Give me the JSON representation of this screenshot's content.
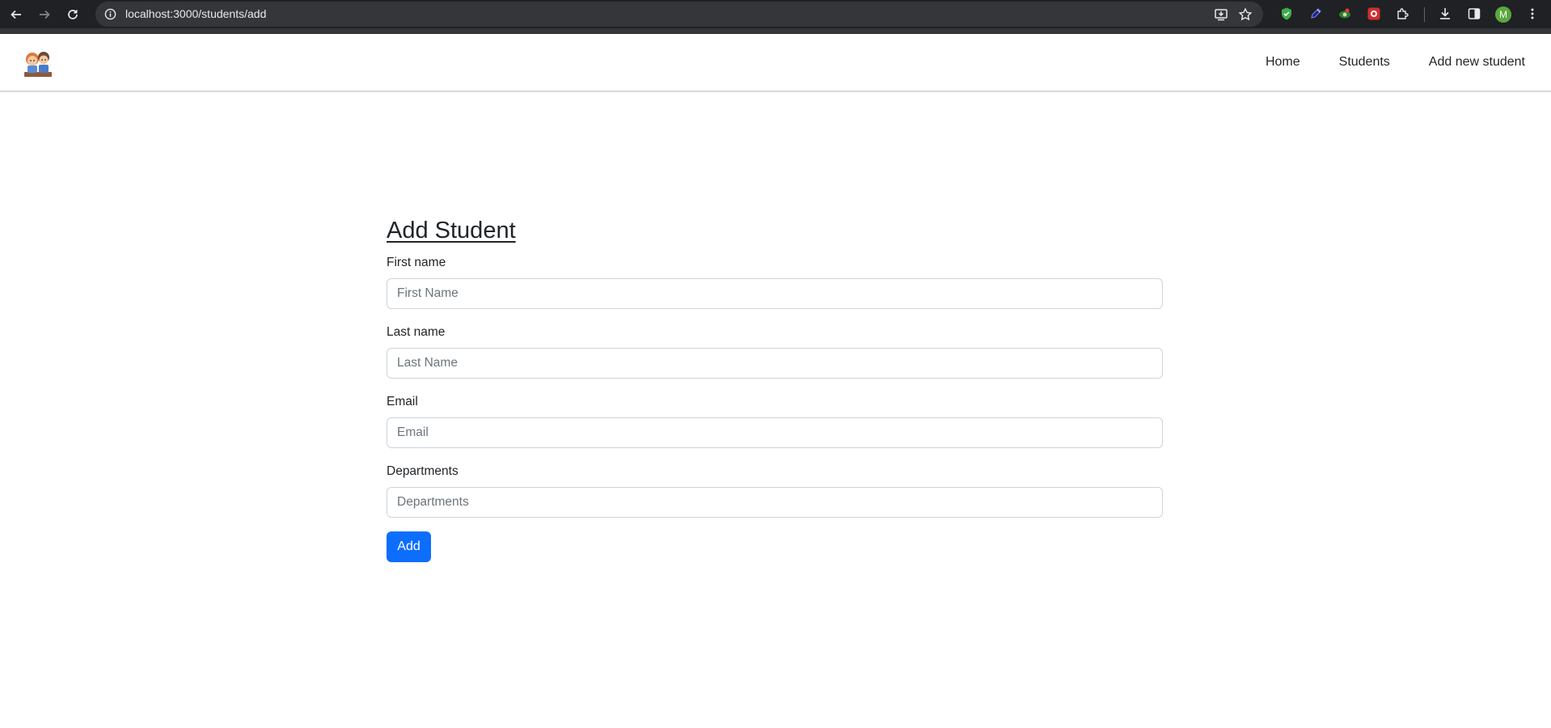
{
  "browser": {
    "url": "localhost:3000/students/add",
    "profile_initial": "M",
    "icons": [
      "back-icon",
      "forward-icon",
      "reload-icon",
      "site-info-icon",
      "install-app-icon",
      "bookmark-star-icon",
      "shield-extension-icon",
      "pen-extension-icon",
      "eye-extension-icon",
      "red-extension-icon",
      "extensions-puzzle-icon",
      "download-icon",
      "side-panel-icon",
      "menu-dots-icon"
    ]
  },
  "navbar": {
    "links": [
      "Home",
      "Students",
      "Add new student"
    ]
  },
  "form": {
    "title": "Add Student",
    "fields": [
      {
        "label": "First name",
        "placeholder": "First Name",
        "value": ""
      },
      {
        "label": "Last name",
        "placeholder": "Last Name",
        "value": ""
      },
      {
        "label": "Email",
        "placeholder": "Email",
        "value": ""
      },
      {
        "label": "Departments",
        "placeholder": "Departments",
        "value": ""
      }
    ],
    "submit_label": "Add"
  },
  "colors": {
    "primary": "#0d6efd",
    "text": "#212529",
    "placeholder": "#6c757d",
    "input_border": "#ced4da",
    "chrome_bg": "#202124"
  }
}
